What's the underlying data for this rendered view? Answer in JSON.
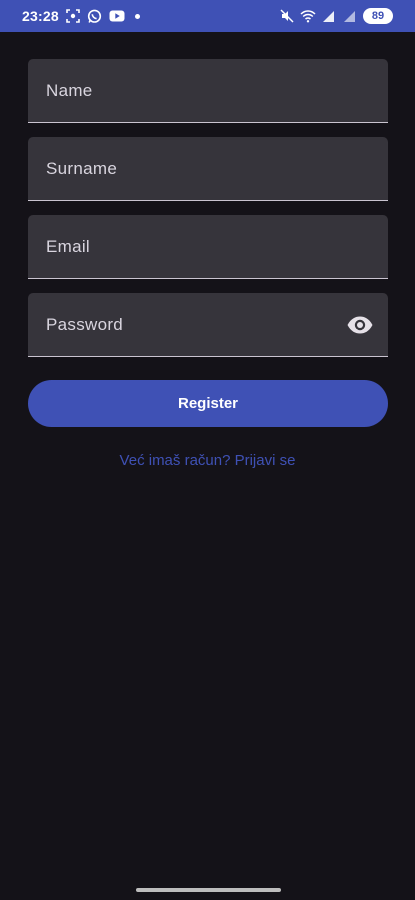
{
  "status_bar": {
    "time": "23:28",
    "battery": "89",
    "left_icons": [
      "screenshot-icon",
      "whatsapp-icon",
      "youtube-icon",
      "dot-icon"
    ],
    "right_icons": [
      "mute-icon",
      "wifi-icon",
      "signal-icon",
      "signal-icon",
      "battery-icon"
    ]
  },
  "form": {
    "name_label": "Name",
    "surname_label": "Surname",
    "email_label": "Email",
    "password_label": "Password",
    "password_toggle_icon": "eye-icon",
    "register_label": "Register",
    "login_link": "Već imaš račun? Prijavi se"
  },
  "colors": {
    "background": "#141218",
    "accent": "#3f51b5",
    "field_fill": "#36343b",
    "field_text": "#d9d5df"
  }
}
